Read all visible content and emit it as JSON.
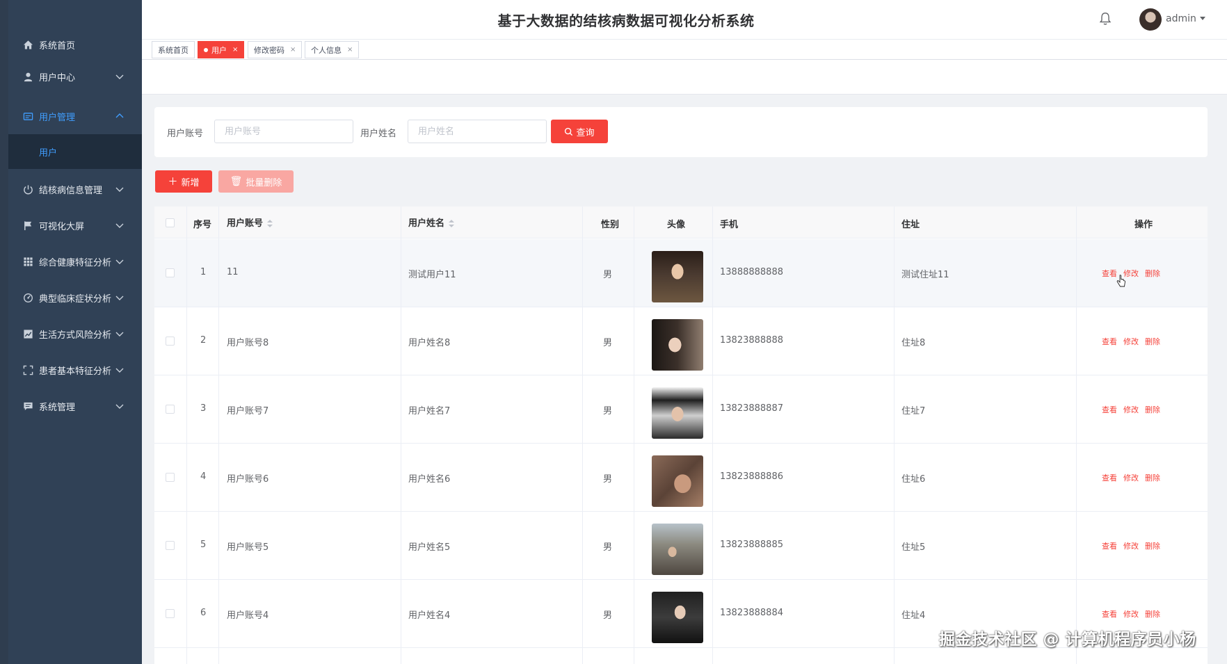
{
  "header": {
    "title": "基于大数据的结核病数据可视化分析系统",
    "user": "admin"
  },
  "sidebar": {
    "items": [
      {
        "label": "系统首页",
        "icon": "home-icon"
      },
      {
        "label": "用户中心",
        "icon": "user-icon"
      },
      {
        "label": "用户管理",
        "icon": "manage-icon"
      },
      {
        "label": "结核病信息管理",
        "icon": "power-icon"
      },
      {
        "label": "可视化大屏",
        "icon": "flag-icon"
      },
      {
        "label": "综合健康特征分析",
        "icon": "grid-icon"
      },
      {
        "label": "典型临床症状分析",
        "icon": "gauge-icon"
      },
      {
        "label": "生活方式风险分析",
        "icon": "chart-icon"
      },
      {
        "label": "患者基本特征分析",
        "icon": "fullscreen-icon"
      },
      {
        "label": "系统管理",
        "icon": "message-icon"
      }
    ],
    "submenu_label": "用户"
  },
  "tags": [
    {
      "label": "系统首页"
    },
    {
      "label": "用户"
    },
    {
      "label": "修改密码"
    },
    {
      "label": "个人信息"
    }
  ],
  "search": {
    "account_label": "用户账号",
    "account_placeholder": "用户账号",
    "name_label": "用户姓名",
    "name_placeholder": "用户姓名",
    "button": "查询"
  },
  "toolbar": {
    "add": "新增",
    "batch_delete": "批量删除"
  },
  "table": {
    "headers": {
      "index": "序号",
      "account": "用户账号",
      "name": "用户姓名",
      "gender": "性别",
      "avatar": "头像",
      "phone": "手机",
      "address": "住址",
      "ops": "操作"
    },
    "actions": {
      "view": "查看",
      "edit": "修改",
      "delete": "删除"
    },
    "rows": [
      {
        "index": "1",
        "account": "11",
        "name": "测试用户11",
        "gender": "男",
        "phone": "13888888888",
        "address": "测试住址11"
      },
      {
        "index": "2",
        "account": "用户账号8",
        "name": "用户姓名8",
        "gender": "男",
        "phone": "13823888888",
        "address": "住址8"
      },
      {
        "index": "3",
        "account": "用户账号7",
        "name": "用户姓名7",
        "gender": "男",
        "phone": "13823888887",
        "address": "住址7"
      },
      {
        "index": "4",
        "account": "用户账号6",
        "name": "用户姓名6",
        "gender": "男",
        "phone": "13823888886",
        "address": "住址6"
      },
      {
        "index": "5",
        "account": "用户账号5",
        "name": "用户姓名5",
        "gender": "男",
        "phone": "13823888885",
        "address": "住址5"
      },
      {
        "index": "6",
        "account": "用户账号4",
        "name": "用户姓名4",
        "gender": "男",
        "phone": "13823888884",
        "address": "住址4"
      }
    ]
  },
  "watermark": "掘金技术社区 @ 计算机程序员小杨",
  "colors": {
    "accent": "#f5423a",
    "sidebar": "#304156",
    "active_menu": "#409eff"
  }
}
